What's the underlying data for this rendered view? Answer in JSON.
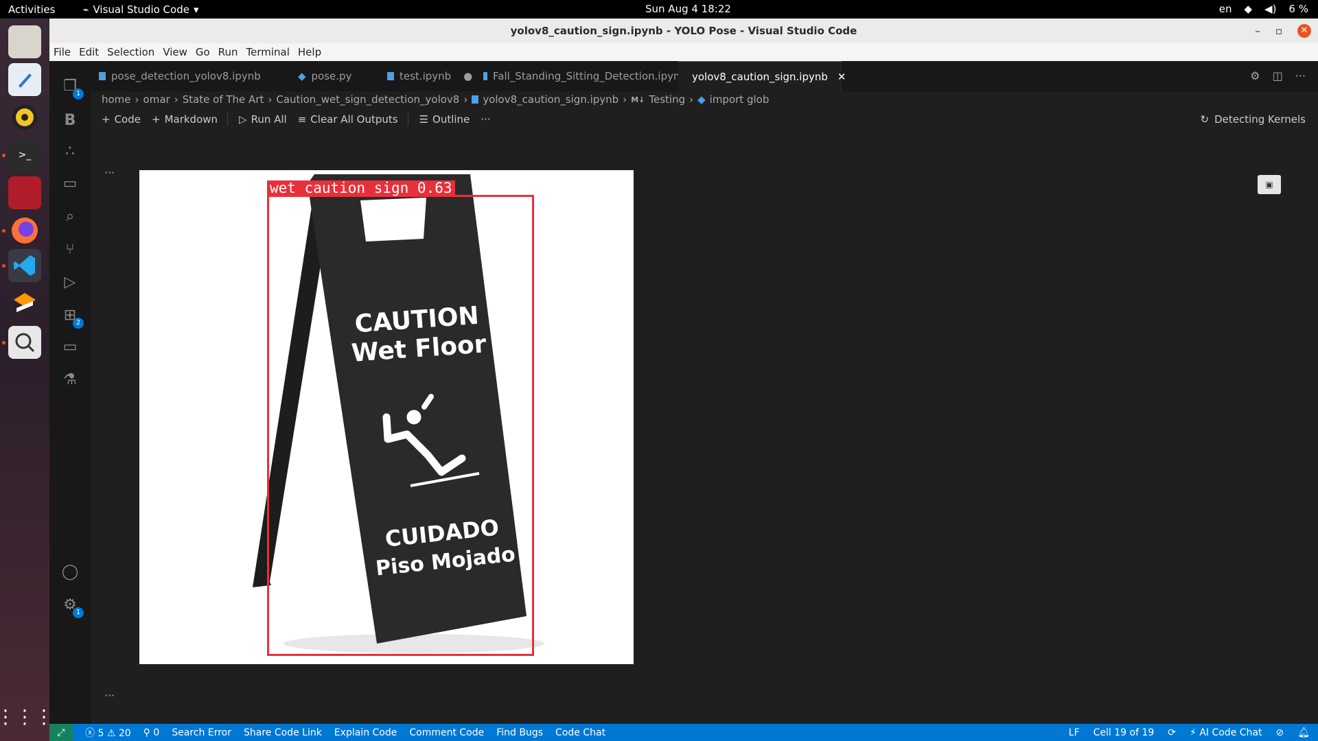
{
  "topbar": {
    "activities": "Activities",
    "app_name": "Visual Studio Code",
    "clock": "Sun Aug 4  18:22",
    "lang": "en",
    "battery": "6 %"
  },
  "window": {
    "title": "yolov8_caution_sign.ipynb - YOLO Pose - Visual Studio Code"
  },
  "menu": [
    "File",
    "Edit",
    "Selection",
    "View",
    "Go",
    "Run",
    "Terminal",
    "Help"
  ],
  "activity_badges": {
    "explorer": "1",
    "extensions": "2",
    "settings": "1"
  },
  "tabs": [
    {
      "label": "pose_detection_yolov8.ipynb"
    },
    {
      "label": "pose.py"
    },
    {
      "label": "test.ipynb"
    },
    {
      "label": "Fall_Standing_Sitting_Detection.ipynb"
    },
    {
      "label": "yolov8_caution_sign.ipynb"
    }
  ],
  "breadcrumb": [
    "home",
    "omar",
    "State of The Art",
    "Caution_wet_sign_detection_yolov8",
    "yolov8_caution_sign.ipynb",
    "Testing",
    "import glob"
  ],
  "breadcrumb_md": "M↓",
  "toolbar": {
    "code": "Code",
    "markdown": "Markdown",
    "run_all": "Run All",
    "clear": "Clear All Outputs",
    "outline": "Outline",
    "more": "···",
    "kernel": "Detecting Kernels"
  },
  "output": {
    "label": "wet caution sign 0.63",
    "sign_line1": "CAUTION",
    "sign_line2": "Wet  Floor",
    "sign_line3": "CUIDADO",
    "sign_line4": "Piso Mojado",
    "box_color": "#e8303a"
  },
  "cell_dots": "···",
  "status": {
    "errors": "5",
    "warnings": "20",
    "ports": "0",
    "items": [
      "Search Error",
      "Share Code Link",
      "Explain Code",
      "Comment Code",
      "Find Bugs",
      "Code Chat"
    ],
    "eol": "LF",
    "cell": "Cell 19 of 19",
    "ai": "AI Code Chat"
  }
}
